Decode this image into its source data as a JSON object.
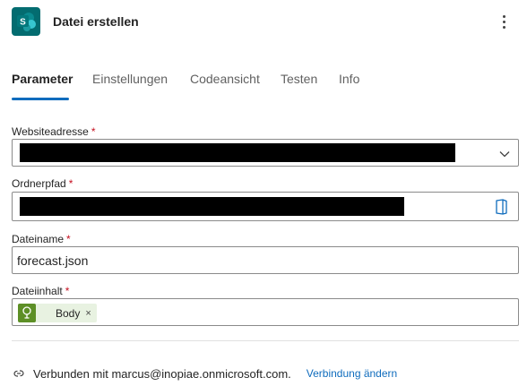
{
  "header": {
    "title": "Datei erstellen",
    "app_icon": "sharepoint-icon",
    "app_icon_letter": "S",
    "more_icon": "more-vertical-icon"
  },
  "tabs": [
    {
      "label": "Parameter",
      "active": true
    },
    {
      "label": "Einstellungen",
      "active": false
    },
    {
      "label": "Codeansicht",
      "active": false
    },
    {
      "label": "Testen",
      "active": false
    },
    {
      "label": "Info",
      "active": false
    }
  ],
  "fields": {
    "site": {
      "label": "Websiteadresse",
      "required_mark": "*",
      "value_redacted": true
    },
    "folder": {
      "label": "Ordnerpfad",
      "required_mark": "*",
      "value_redacted": true
    },
    "filename": {
      "label": "Dateiname",
      "required_mark": "*",
      "value": "forecast.json"
    },
    "content": {
      "label": "Dateiinhalt",
      "required_mark": "*",
      "token_label": "Body",
      "token_close": "×"
    }
  },
  "connection": {
    "text": "Verbunden mit marcus@inopiae.onmicrosoft.com.",
    "link_label": "Verbindung ändern"
  },
  "colors": {
    "accent": "#0f6cbd",
    "sharepoint": "#036c70",
    "token_icon": "#5d8f26",
    "token_bg": "#e8f2e1",
    "required": "#c50f1f"
  }
}
